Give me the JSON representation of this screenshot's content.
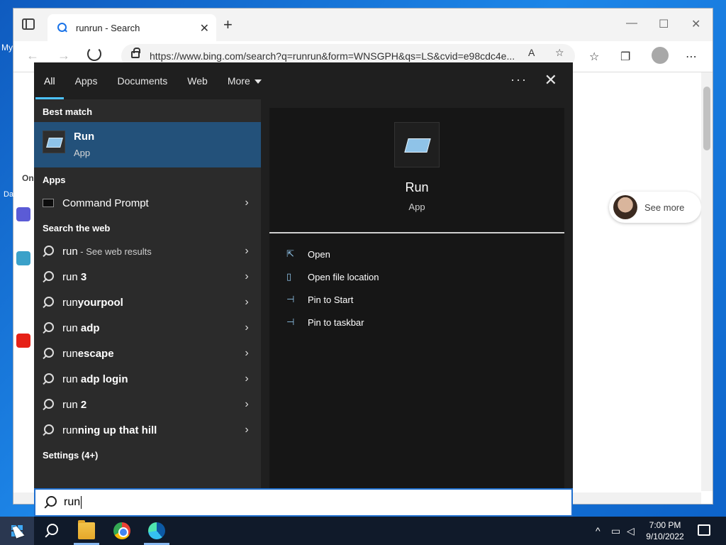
{
  "desktop": {
    "label": "My"
  },
  "browser": {
    "tab_title": "runrun - Search",
    "url": "https://www.bing.com/search?q=runrun&form=WNSGPH&qs=LS&cvid=e98cdc4e...",
    "see_more": "See more",
    "left_strip_label": "On",
    "left_strip_label2": "Da"
  },
  "search": {
    "tabs": [
      "All",
      "Apps",
      "Documents",
      "Web",
      "More"
    ],
    "sections": {
      "best_match": "Best match",
      "apps": "Apps",
      "web": "Search the web",
      "settings": "Settings (4+)"
    },
    "best": {
      "title": "Run",
      "subtitle": "App"
    },
    "apps_items": [
      {
        "label": "Command Prompt"
      }
    ],
    "web_items": [
      {
        "prefix": "run",
        "bold": "",
        "suffix": " - See web results"
      },
      {
        "prefix": "run",
        "bold": " 3",
        "suffix": ""
      },
      {
        "prefix": "run",
        "bold": "yourpool",
        "suffix": ""
      },
      {
        "prefix": "run",
        "bold": " adp",
        "suffix": ""
      },
      {
        "prefix": "run",
        "bold": "escape",
        "suffix": ""
      },
      {
        "prefix": "run",
        "bold": " adp login",
        "suffix": ""
      },
      {
        "prefix": "run",
        "bold": " 2",
        "suffix": ""
      },
      {
        "prefix": "run",
        "bold": "ning up that hill",
        "suffix": ""
      }
    ],
    "preview": {
      "title": "Run",
      "subtitle": "App"
    },
    "actions": [
      "Open",
      "Open file location",
      "Pin to Start",
      "Pin to taskbar"
    ],
    "query": "run"
  },
  "taskbar": {
    "time": "7:00 PM",
    "date": "9/10/2022"
  },
  "colors": {
    "accent": "#4cc2ff",
    "selected": "#23517a",
    "panel": "#1f1f1f"
  }
}
